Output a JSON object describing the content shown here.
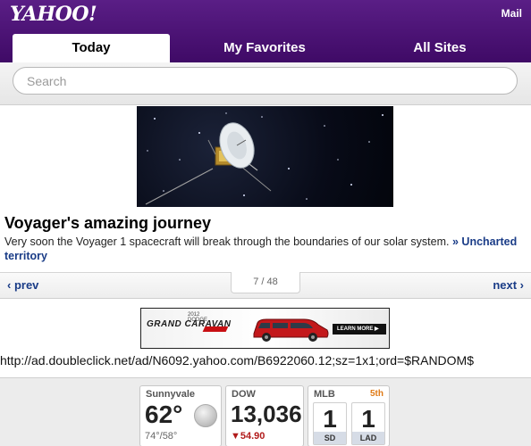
{
  "header": {
    "logo": "YAHOO!",
    "mail_link": "Mail",
    "tabs": [
      {
        "label": "Today",
        "active": true
      },
      {
        "label": "My Favorites",
        "active": false
      },
      {
        "label": "All Sites",
        "active": false
      }
    ]
  },
  "search": {
    "placeholder": "Search"
  },
  "story": {
    "image_alt": "Voyager spacecraft",
    "title": "Voyager's amazing journey",
    "text": "Very soon the Voyager 1 spacecraft will break through the boundaries of our solar system.",
    "link_prefix": "»",
    "link_text": "Uncharted territory"
  },
  "pager": {
    "prev": "‹ prev",
    "next": "next ›",
    "current": "7",
    "separator": "/",
    "total": "48"
  },
  "ad": {
    "year": "2012",
    "brand_small": "DODGE",
    "brand": "GRAND CARAVAN",
    "cta": "LEARN MORE ▶",
    "url_text": "http://ad.doubleclick.net/ad/N6092.yahoo.com/B6922060.12;sz=1x1;ord=$RANDOM$"
  },
  "widgets": {
    "weather": {
      "city": "Sunnyvale",
      "temp": "62°",
      "range": "74°/58°",
      "icon": "moon-icon"
    },
    "dow": {
      "label": "DOW",
      "value": "13,036",
      "change": "▼54.90"
    },
    "mlb": {
      "label": "MLB",
      "tag": "5th",
      "scores": [
        {
          "team": "SD",
          "score": "1"
        },
        {
          "team": "LAD",
          "score": "1"
        }
      ]
    }
  },
  "colors": {
    "header": "#4a1174",
    "link": "#1a3c87",
    "down": "#b11a1a",
    "accent": "#e07a16"
  }
}
